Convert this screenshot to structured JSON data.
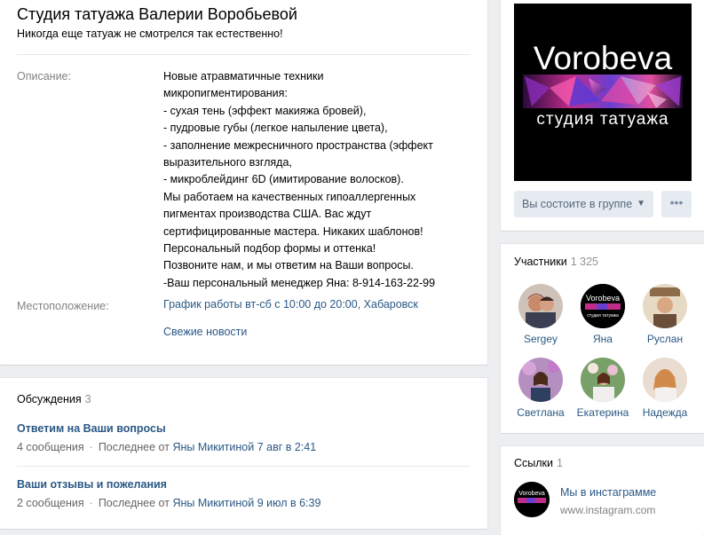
{
  "group": {
    "title": "Студия татуажа Валерии Воробьевой",
    "status": "Никогда еще татуаж не смотрелся так естественно!"
  },
  "info": {
    "description_label": "Описание:",
    "description_lines": [
      "Новые атравматичные техники",
      "микропигментирования:",
      "- сухая тень (эффект макияжа бровей),",
      "- пудровые губы (легкое напыление цвета),",
      "- заполнение межресничного пространства (эффект",
      "выразительного взгляда,",
      "- микроблейдинг 6D (имитирование волосков).",
      "Мы работаем на качественных гипоаллергенных",
      "пигментах производства США. Вас ждут",
      "сертифицированные мастера. Никаких шаблонов!",
      "Персональный подбор формы и оттенка!",
      "Позвоните нам, и мы ответим на Ваши вопросы.",
      "-Ваш персональный менеджер Яна: 8-914-163-22-99"
    ],
    "location_label": "Местоположение:",
    "location_value": "График работы вт-сб с 10:00 до 20:00, Хабаровск",
    "news_link": "Свежие новости"
  },
  "discussions": {
    "header": "Обсуждения",
    "count": "3",
    "topics": [
      {
        "title": "Ответим на Ваши вопросы",
        "messages": "4 сообщения",
        "last_prefix": "Последнее от",
        "last_author": "Яны Микитиной",
        "last_date": "7 авг в 2:41"
      },
      {
        "title": "Ваши отзывы и пожелания",
        "messages": "2 сообщения",
        "last_prefix": "Последнее от",
        "last_author": "Яны Микитиной",
        "last_date": "9 июл в 6:39"
      }
    ]
  },
  "cover": {
    "brand": "Vorobeva",
    "subtitle": "студия татуажа"
  },
  "actions": {
    "joined": "Вы состоите в группе",
    "more": "•••"
  },
  "members": {
    "header": "Участники",
    "count": "1 325",
    "list": [
      "Sergey",
      "Яна",
      "Руслан",
      "Светлана",
      "Екатерина",
      "Надежда"
    ]
  },
  "links": {
    "header": "Ссылки",
    "count": "1",
    "items": [
      {
        "title": "Мы в инстаграмме",
        "url": "www.instagram.com"
      }
    ]
  },
  "colors": {
    "link": "#2a5885",
    "muted": "#828282",
    "button_bg": "#e5ebf1"
  }
}
